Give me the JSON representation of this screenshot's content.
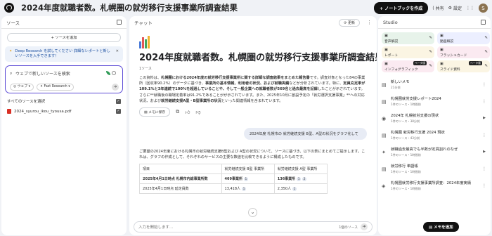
{
  "header": {
    "title": "2024年度就職者数。札幌圏の就労移行支援事業所調査結果",
    "create_notebook": "+ ノートブックを作成",
    "share": "共有",
    "settings": "設定",
    "avatar_letter": "S"
  },
  "sources": {
    "heading": "ソース",
    "add_source": "+ ソースを追加",
    "promo": "Deep Research を試してください 詳細なレポートと新しいソースを入手できます！",
    "search_placeholder": "ウェブで新しいソースを検索",
    "chip_web": "ウェブ",
    "chip_fast": "Fast Research",
    "select_all": "すべてのソースを選択",
    "files": [
      "2024_syurou_ikou_tyousa.pdf"
    ]
  },
  "chat": {
    "heading": "チャット",
    "refresh": "更新",
    "doc_title": "2024年度就職者数。札幌圏の就労移行支援事業所調査結果",
    "source_count": "1ソース",
    "summary": [
      {
        "t": "この資料は、",
        "b": false
      },
      {
        "t": "札幌圏における2024年度の就労移行支援事業所に関する詳細な調査結果をまとめた報告書",
        "b": true
      },
      {
        "t": "です。調査対象となった84の事業所（回収率90.2%）のデータに基づき、",
        "b": false
      },
      {
        "t": "事業所の基本情報、利用者の状況、および就職実績",
        "b": true
      },
      {
        "t": "などが分析されています。特に、",
        "b": false
      },
      {
        "t": "定員充足率が109.1%と3年連続で100%を超過",
        "b": true
      },
      {
        "t": "していることや、そして一般企業への就職者数が569名と過去最高を記録",
        "b": true
      },
      {
        "t": "したことが示されています。さらに**就職後の職場定着率は91.2%であることがが示されています。また、2025年10月に創設予定の「就労選択支援事業」**への対応状況、および",
        "b": false
      },
      {
        "t": "就労継続支援A型・B型事業所の状況",
        "b": true
      },
      {
        "t": "といった関連情報を含まれています。",
        "b": false
      }
    ],
    "save_note": "メモに保存",
    "user_message": "2024年度 札幌市の 就労継続支援 B型、A型の状況をグラフ化して",
    "answer": "ご要望の2024年度における札幌市の就労継続支援B型および A型の状況について、ソースに基づき、以下の表にまとめてご提示します。これは、グラフの作成として、それぞれのサービスの主要な数値を比較できるように構成したものです。",
    "table": [
      [
        "項目",
        "就労継続支援 B型 事業所",
        "就労継続支援 A型 事業所"
      ],
      [
        "2025年4月1日時点 札幌市内総事業所数",
        "469事業所",
        "136事業所"
      ],
      [
        "2025年4月1日時点 延定員数",
        "13,418人",
        "2,350人"
      ]
    ],
    "input_placeholder": "入力を開始します...",
    "source_counter": "1個のソース"
  },
  "studio": {
    "heading": "Studio",
    "tiles": [
      {
        "label": "音声解説",
        "color": "g"
      },
      {
        "label": "動画解説",
        "color": "b"
      },
      {
        "label": "マインドマップ",
        "color": "pk"
      },
      {
        "label": "レポート",
        "color": "y"
      },
      {
        "label": "フラッシュカード",
        "color": "pk"
      },
      {
        "label": "テスト",
        "color": "b"
      },
      {
        "label": "インフォグラフィック",
        "color": "pk",
        "badge": "ベータ版"
      },
      {
        "label": "スライド資料",
        "color": "y",
        "badge": "ベータ版"
      }
    ],
    "notes": [
      {
        "icon": "▤",
        "title": "新しいメモ",
        "sub": "21分前"
      },
      {
        "icon": "▤",
        "title": "札幌圏就労支援レポート2024",
        "sub": "1件のソース・1時間前"
      },
      {
        "icon": "◉",
        "title": "2024年 札幌就労支援の現状",
        "sub": "1件のソース・38分前"
      },
      {
        "icon": "▤",
        "title": "札幌圏 就労移行支援 2024 現状",
        "sub": "1件のソース・43分前"
      },
      {
        "icon": "✦",
        "title": "就職過去最高でも半数が定員割れのなぜ",
        "sub": "1件のソース・1時間前"
      },
      {
        "icon": "▤",
        "title": "就労移行 単語帳",
        "sub": "1件のソース・1時間前"
      },
      {
        "icon": "◈",
        "title": "札幌圏就労移行支援事業所調査：2024年度実績",
        "sub": "1件のソース・1時間前"
      }
    ],
    "add_memo": "メモを追加"
  }
}
